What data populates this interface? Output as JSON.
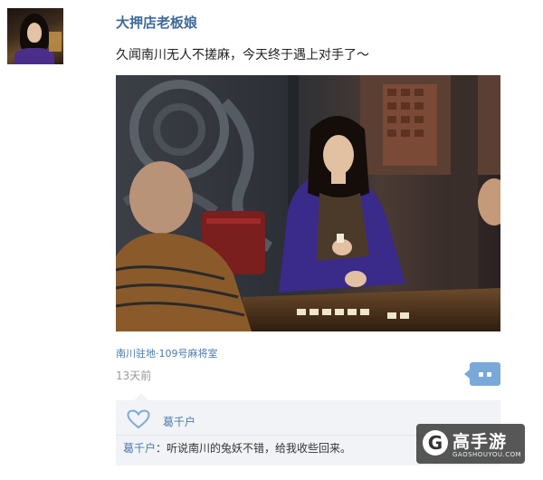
{
  "post": {
    "username": "大押店老板娘",
    "text": "久闻南川无人不搓麻，今天终于遇上对手了～",
    "location": "南川驻地·109号麻将室",
    "time_ago": "13天前"
  },
  "icons": {
    "comment_button": "comment-bubble-icon",
    "like": "heart-icon"
  },
  "likes": {
    "names": "葛千户"
  },
  "comments": [
    {
      "author": "葛千户",
      "separator": "：",
      "text": "听说南川的兔妖不错，给我收些回来。"
    }
  ],
  "watermark": {
    "logo": "G",
    "name": "高手游",
    "url": "GAOSHOUYOU.COM"
  },
  "colors": {
    "link": "#3f6a9b",
    "accent": "#7aa8d8",
    "panel": "#f2f3f6"
  }
}
